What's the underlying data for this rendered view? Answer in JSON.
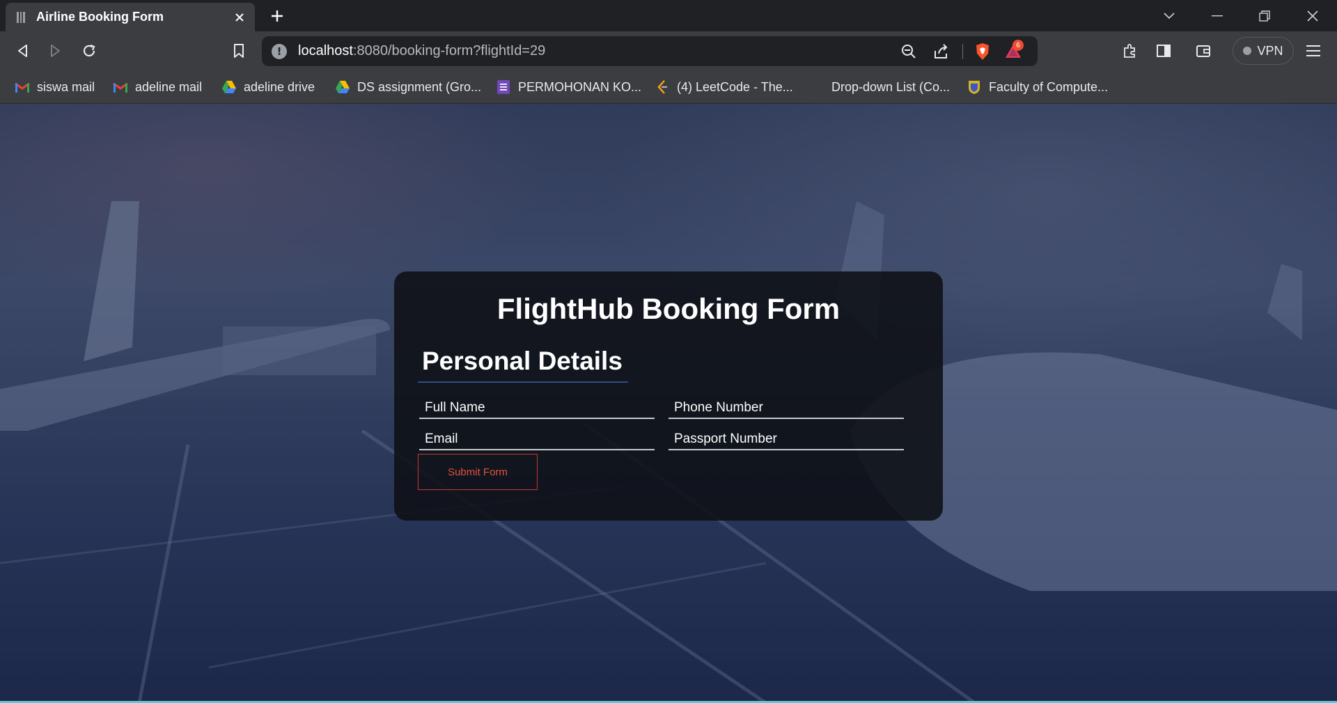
{
  "browser": {
    "tab_title": "Airline Booking Form",
    "url_host": "localhost",
    "url_rest": ":8080/booking-form?flightId=29",
    "brave_badge": "6",
    "vpn_label": "VPN"
  },
  "bookmarks": [
    {
      "label": "siswa mail",
      "icon": "gmail-icon"
    },
    {
      "label": "adeline mail",
      "icon": "gmail-icon"
    },
    {
      "label": "adeline drive",
      "icon": "google-drive-icon"
    },
    {
      "label": "DS assignment (Gro...",
      "icon": "google-drive-icon"
    },
    {
      "label": "PERMOHONAN KO...",
      "icon": "google-forms-icon"
    },
    {
      "label": "(4) LeetCode - The...",
      "icon": "leetcode-icon"
    },
    {
      "label": "Drop-down List (Co...",
      "icon": ""
    },
    {
      "label": "Faculty of Compute...",
      "icon": "faculty-crest-icon"
    }
  ],
  "form": {
    "title": "FlightHub Booking Form",
    "section_title": "Personal Details",
    "fields": {
      "full_name": "Full Name",
      "phone_number": "Phone Number",
      "email": "Email",
      "passport_number": "Passport Number"
    },
    "submit_label": "Submit Form"
  },
  "colors": {
    "card_bg": "#0e1016",
    "submit_border": "#c0392b",
    "underline_accent": "#2e4f86"
  }
}
